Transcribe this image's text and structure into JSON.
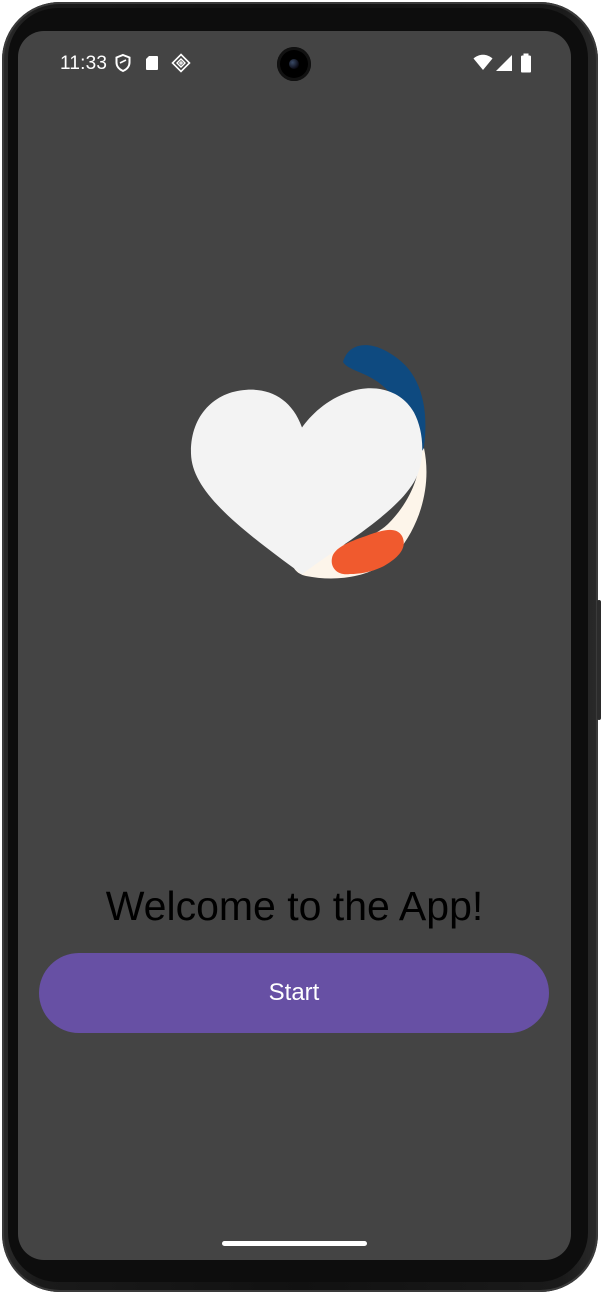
{
  "status_bar": {
    "time": "11:33",
    "left_icons": [
      "shield-icon",
      "sd-card-icon",
      "cast-diamond-icon"
    ],
    "right_icons": [
      "wifi-icon",
      "cellular-signal-icon",
      "battery-icon"
    ]
  },
  "main": {
    "welcome_text": "Welcome to the App!",
    "start_button_label": "Start"
  },
  "colors": {
    "screen_background": "#444444",
    "button_background": "#6750a4",
    "button_text": "#ffffff",
    "welcome_text": "#000000",
    "logo_heart": "#f3f3f3",
    "logo_blue": "#0e4a80",
    "logo_cream": "#fdf5ea",
    "logo_orange": "#f05a2e"
  }
}
